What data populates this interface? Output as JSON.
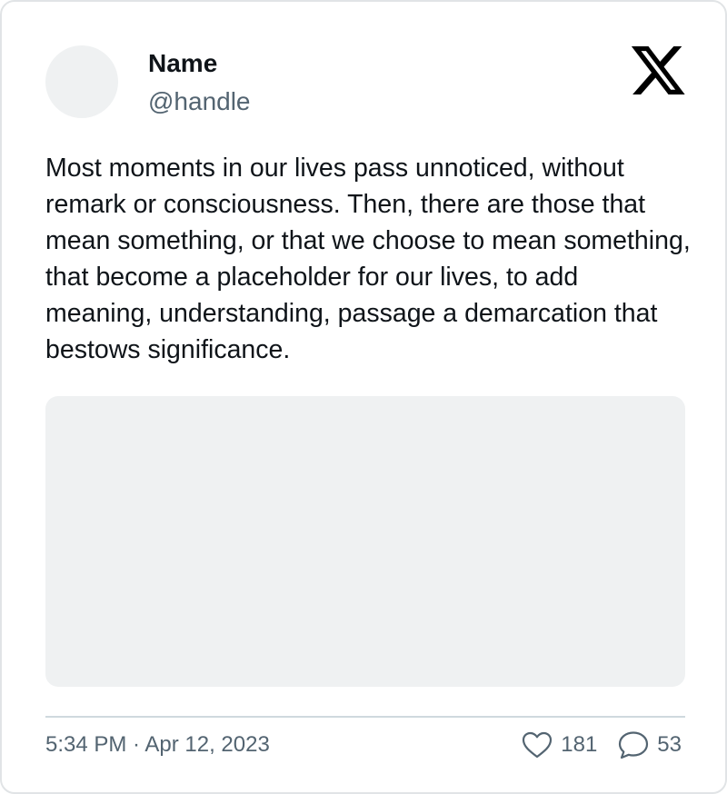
{
  "author": {
    "name": "Name",
    "handle": "@handle"
  },
  "logo": {
    "icon": "x-logo-icon"
  },
  "tweet": {
    "text": "Most moments in our lives pass unnoticed, without remark or consciousness. Then, there are those that mean something, or that we choose to mean something, that become a placeholder for our lives, to add meaning, understanding, passage a demarcation that bestows significance."
  },
  "footer": {
    "timestamp": "5:34 PM · Apr 12, 2023",
    "likes": {
      "icon": "heart-icon",
      "count": "181"
    },
    "replies": {
      "icon": "reply-bubble-icon",
      "count": "53"
    }
  },
  "colors": {
    "text_primary": "#0f1419",
    "text_secondary": "#536471",
    "placeholder_fill": "#eff1f2",
    "border": "#e1e4e6"
  }
}
